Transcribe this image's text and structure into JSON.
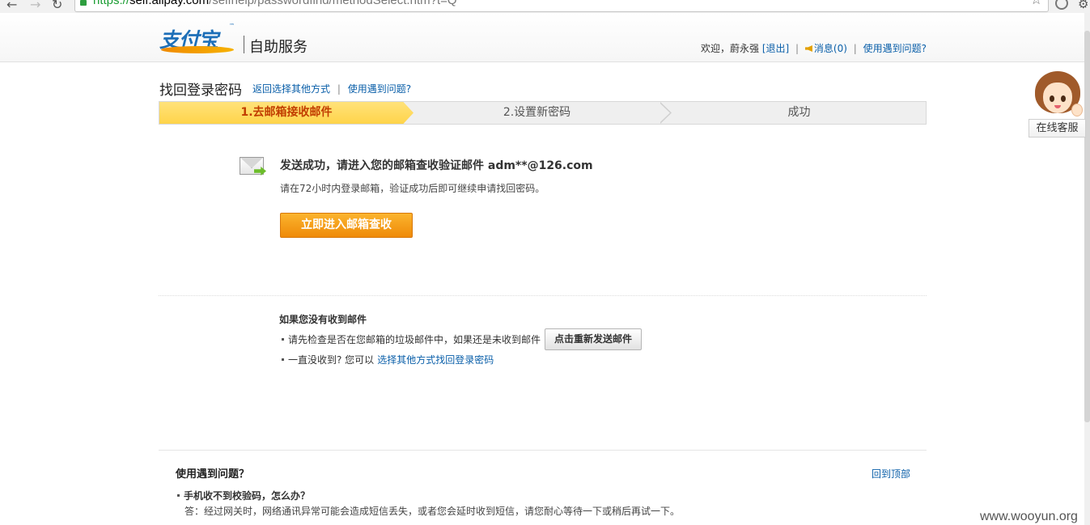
{
  "browser": {
    "url_scheme": "https://",
    "url_host": "self.alipay.com",
    "url_path": "/selfhelp/passwordfind/methodSelect.htm?t=Q"
  },
  "header": {
    "logo_text": "支付宝",
    "logo_tm": "™",
    "service_title": "自助服务",
    "welcome": "欢迎，蔚永强",
    "logout": "[退出]",
    "messages": "消息(0)",
    "help": "使用遇到问题?"
  },
  "section": {
    "title": "找回登录密码",
    "link_back": "返回选择其他方式",
    "link_help": "使用遇到问题?"
  },
  "steps": [
    {
      "label": "1.去邮箱接收邮件",
      "active": true
    },
    {
      "label": "2.设置新密码",
      "active": false
    },
    {
      "label": "成功",
      "active": false
    }
  ],
  "message": {
    "title": "发送成功，请进入您的邮箱查收验证邮件 adm**@126.com",
    "subtitle": "请在72小时内登录邮箱，验证成功后即可继续申请找回密码。",
    "button": "立即进入邮箱查收"
  },
  "tips": {
    "title": "如果您没有收到邮件",
    "tip1": "请先检查是否在您邮箱的垃圾邮件中，如果还是未收到邮件",
    "resend_button": "点击重新发送邮件",
    "tip2": "一直没收到? 您可以",
    "tip2_link": "选择其他方式找回登录密码"
  },
  "faq": {
    "title": "使用遇到问题？",
    "back_to_top": "回到顶部",
    "question": "手机收不到校验码，怎么办？",
    "answer": "答：经过网关时，网络通讯异常可能会造成短信丢失，或者您会延时收到短信，请您耐心等待一下或稍后再试一下。"
  },
  "customer_service": {
    "label": "在线客服"
  },
  "watermark": "www.wooyun.org"
}
